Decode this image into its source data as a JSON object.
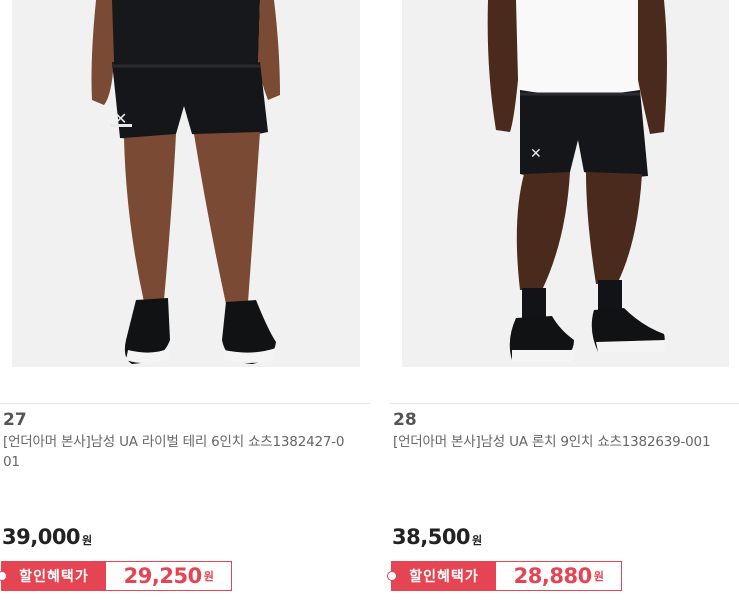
{
  "products": [
    {
      "rank": "27",
      "name": "[언더아머 본사]남성 UA 라이벌 테리 6인치 쇼츠1382427-001",
      "price": "39,000",
      "price_unit": "원",
      "benefit_label": "할인혜택가",
      "discount_price": "29,250",
      "discount_unit": "원"
    },
    {
      "rank": "28",
      "name": "[언더아머 본사]남성 UA 론치 9인치 쇼츠1382639-001",
      "price": "38,500",
      "price_unit": "원",
      "benefit_label": "할인혜택가",
      "discount_price": "28,880",
      "discount_unit": "원"
    }
  ],
  "colors": {
    "accent": "#e54452",
    "image_bg": "#f1f1f1",
    "shorts": "#15161a",
    "skin_1": "#7a4a34",
    "skin_2": "#4a2a1c"
  }
}
